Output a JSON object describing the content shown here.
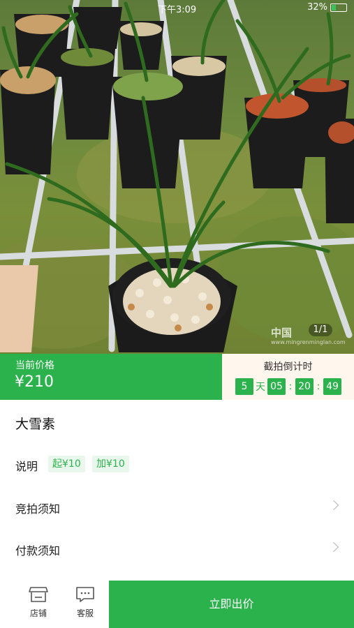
{
  "status_bar": {
    "time": "下午3:09",
    "battery": "32%"
  },
  "hero": {
    "image_counter": "1/1",
    "watermark": "中国",
    "watermark_url": "www.mingrenminglan.com"
  },
  "price": {
    "label": "当前价格",
    "value": "¥210"
  },
  "countdown": {
    "label": "截拍倒计时",
    "days": "5",
    "days_unit": "天",
    "hours": "05",
    "minutes": "20",
    "seconds": "49",
    "separator": ":"
  },
  "item": {
    "title": "大雪素"
  },
  "rows": {
    "description_label": "说明",
    "start_price": "起¥10",
    "increment": "加¥10",
    "bidding_notice": "竞拍须知",
    "payment_notice": "付款须知"
  },
  "bottom": {
    "shop_label": "店铺",
    "service_label": "客服",
    "bid_button": "立即出价"
  },
  "colors": {
    "accent": "#2bb24c",
    "accent_light": "#e9f7ec",
    "countdown_bg": "#fff6ee"
  }
}
